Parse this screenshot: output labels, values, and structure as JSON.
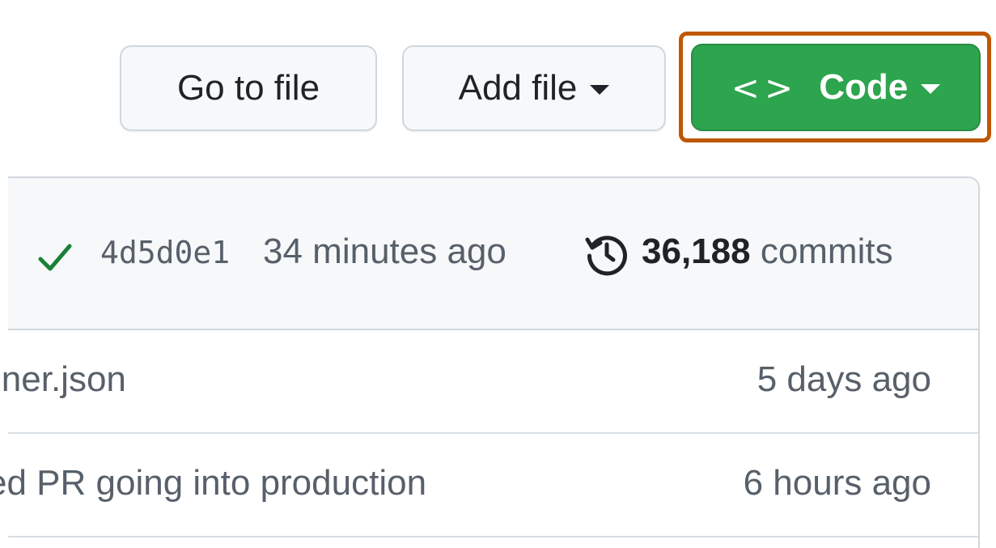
{
  "toolbar": {
    "go_to_file_label": "Go to file",
    "add_file_label": "Add file",
    "code_label": "Code",
    "code_glyph": "<>"
  },
  "latest_commit": {
    "sha": "4d5d0e1",
    "time": "34 minutes ago",
    "commit_count": "36,188",
    "commit_count_suffix": "commits",
    "status_icon": "check-icon",
    "history_icon": "history-icon"
  },
  "rows": [
    {
      "message": "iner.json",
      "time": "5 days ago"
    },
    {
      "message": "ed PR going into production",
      "time": "6 hours ago"
    }
  ],
  "colors": {
    "primary_green": "#2da44e",
    "highlight_orange": "#bf5700",
    "check_green": "#1a7f37",
    "muted_text": "#57606a"
  }
}
